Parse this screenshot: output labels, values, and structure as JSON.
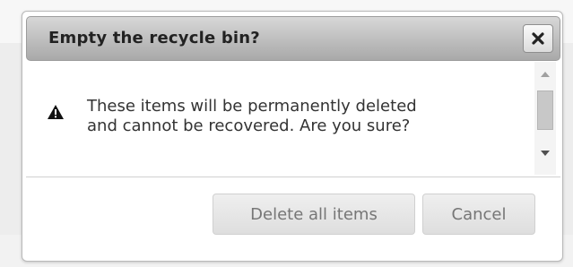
{
  "dialog": {
    "title": "Empty the recycle bin?",
    "close_icon": "close-icon",
    "warning_icon": "warning-triangle-icon",
    "message_line1": "These items will be permanently deleted",
    "message_line2": "and cannot be recovered. Are you sure?",
    "buttons": {
      "delete_label": "Delete all items",
      "cancel_label": "Cancel"
    }
  },
  "colors": {
    "titlebar": "#bdbdbd",
    "title_text": "#222222",
    "button_text": "#767676"
  }
}
